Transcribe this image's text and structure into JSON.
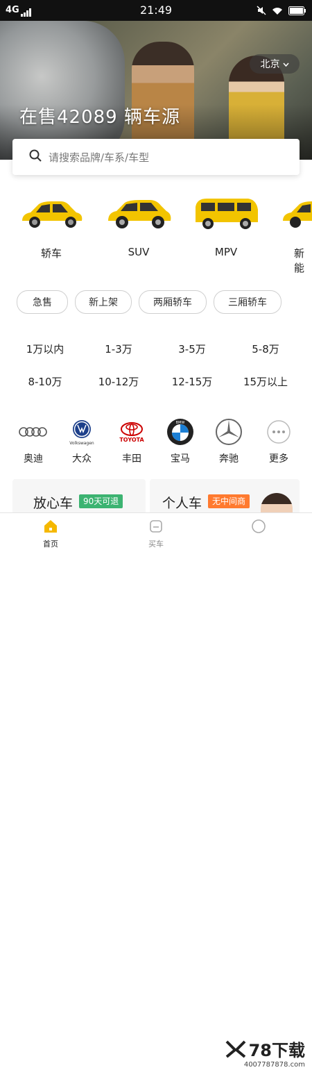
{
  "status_bar": {
    "network": "4G",
    "time": "21:49",
    "battery_icon": "battery-icon",
    "wifi_icon": "wifi-icon",
    "mute_icon": "mute-icon"
  },
  "hero": {
    "city": "北京",
    "title": "在售42089 辆车源"
  },
  "search": {
    "placeholder": "请搜索品牌/车系/车型",
    "icon": "search-icon"
  },
  "car_types": [
    {
      "label": "轿车",
      "icon": "sedan-icon"
    },
    {
      "label": "SUV",
      "icon": "suv-icon"
    },
    {
      "label": "MPV",
      "icon": "mpv-icon"
    },
    {
      "label": "新能",
      "icon": "new-energy-car-icon"
    }
  ],
  "tags": [
    "急售",
    "新上架",
    "两厢轿车",
    "三厢轿车"
  ],
  "prices": [
    "1万以内",
    "1-3万",
    "3-5万",
    "5-8万",
    "8-10万",
    "10-12万",
    "12-15万",
    "15万以上"
  ],
  "brands": [
    {
      "label": "奥迪",
      "icon": "audi-logo",
      "logo_text": ""
    },
    {
      "label": "大众",
      "icon": "volkswagen-logo",
      "logo_text": "Volkswagen"
    },
    {
      "label": "丰田",
      "icon": "toyota-logo",
      "logo_text": "TOYOTA"
    },
    {
      "label": "宝马",
      "icon": "bmw-logo",
      "logo_text": "BMW"
    },
    {
      "label": "奔驰",
      "icon": "mercedes-logo",
      "logo_text": ""
    },
    {
      "label": "更多",
      "icon": "more-icon",
      "logo_text": ""
    }
  ],
  "cards": [
    {
      "title": "放心车",
      "badge": "90天可退",
      "badge_color": "#3cb371"
    },
    {
      "title": "个人车",
      "badge": "无中间商",
      "badge_color": "#ff7a2f"
    }
  ],
  "tabbar": [
    {
      "label": "首页",
      "icon": "home-icon",
      "active": true
    },
    {
      "label": "买车",
      "icon": "buy-car-icon",
      "active": false
    },
    {
      "label": "",
      "icon": "message-icon",
      "active": false
    }
  ],
  "watermark": {
    "brand": "78下载",
    "url": "4007787878.com"
  },
  "colors": {
    "accent": "#f5b800",
    "car_yellow": "#f2c400"
  }
}
